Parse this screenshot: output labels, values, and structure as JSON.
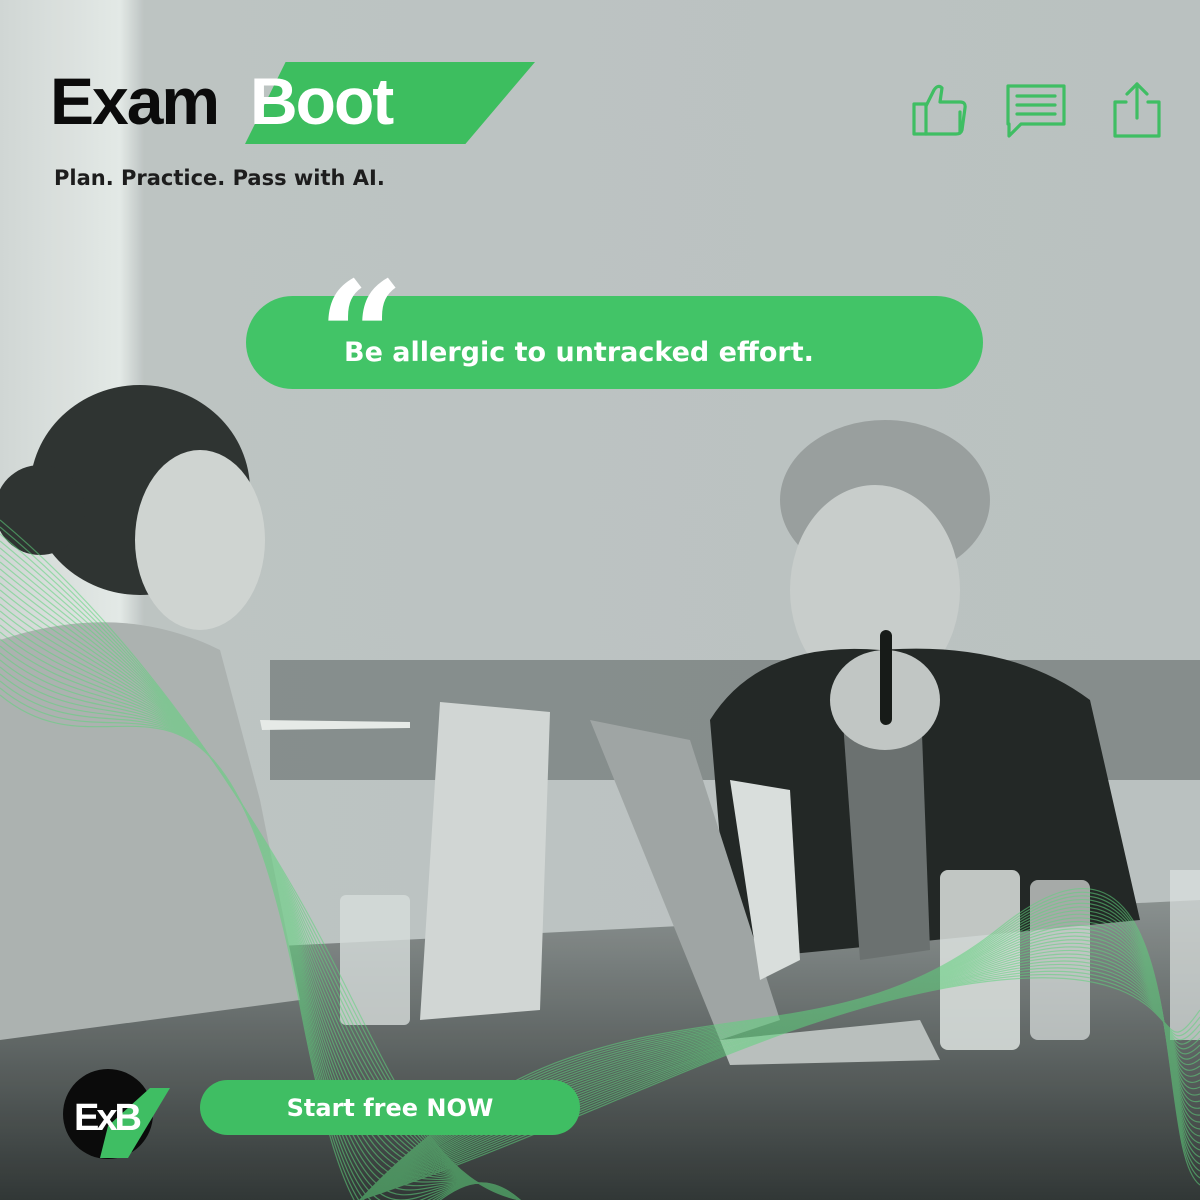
{
  "brand": {
    "logo_part1": "Exam",
    "logo_part2": "Boot",
    "tagline": "Plan. Practice. Pass with AI.",
    "accent_color": "#3fbe63"
  },
  "header_icons": [
    {
      "icon": "thumbs-up-icon"
    },
    {
      "icon": "comment-icon"
    },
    {
      "icon": "share-icon"
    }
  ],
  "quote": {
    "mark": "“",
    "text": "Be allergic to untracked effort."
  },
  "footer": {
    "badge_text": "ExB",
    "cta_label": "Start free NOW"
  }
}
